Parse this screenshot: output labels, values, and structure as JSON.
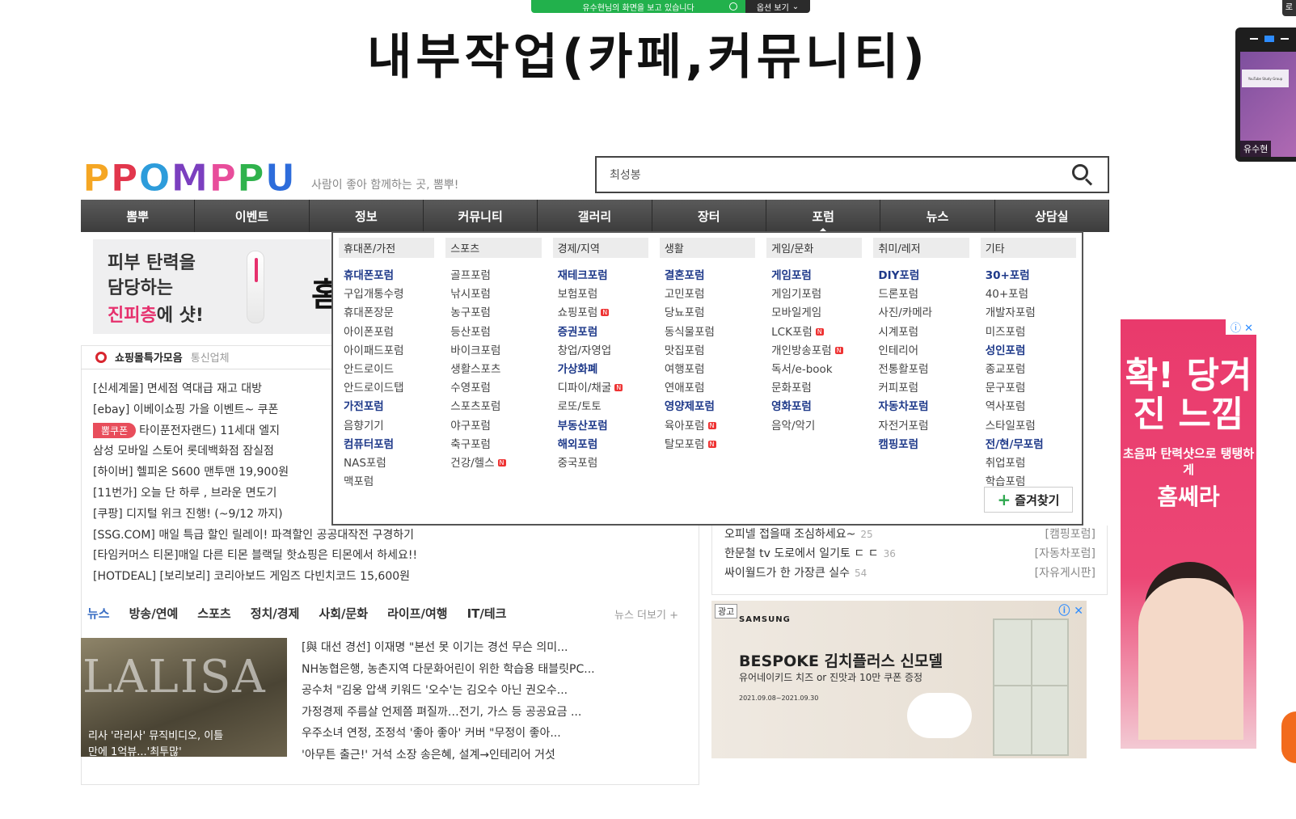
{
  "share_bar": {
    "message": "유수현님의 화면을 보고 있습니다",
    "options_label": "옵션 보기",
    "chevron": "chevron-down-icon"
  },
  "slide_title": "내부작업(카페,커뮤니티)",
  "corner_button_label": "로",
  "video_tile": {
    "participant_name": "유수현",
    "card_text": "YouTube Study Group"
  },
  "site": {
    "logo": "PPOMPPU",
    "tagline": "사람이 좋아 함께하는 곳, 뽐뿌!",
    "search": {
      "value": "최성봉",
      "icon": "search-icon"
    },
    "nav": [
      "뽐뿌",
      "이벤트",
      "정보",
      "커뮤니티",
      "갤러리",
      "장터",
      "포럼",
      "뉴스",
      "상담실"
    ],
    "skin_ad": {
      "line1": "피부 탄력을",
      "line2": "담당하는",
      "line3_highlight": "진피층",
      "line3_rest": "에 샷!",
      "big_char": "홈"
    },
    "shop_header": {
      "title": "쇼핑몰특가모음",
      "second": "통신업체"
    },
    "hot_deals": [
      "[신세계몰] 면세점 역대급 재고 대방",
      "[ebay] 이베이쇼핑 가을 이벤트~ 쿠폰 ",
      "타이푼전자랜드) 11세대 엘지",
      "삼성 모바일 스토어 롯데백화점 잠실점",
      "[하이버] 헬피온 S600 맨투맨 19,900원",
      "[11번가] 오늘 단 하루 , 브라운 면도기",
      "[쿠팡] 디지털 위크 진행! (~9/12 까지)",
      "[SSG.COM] 매일 특급 할인 릴레이! 파격할인 공공대작전 구경하기",
      "[타임커머스 티몬]매일 다른 티몬 블랙딜 핫쇼핑은 티몬에서 하세요!!",
      "[HOTDEAL] [보리보리] 코리아보드 게임즈 다빈치코드 15,600원"
    ],
    "coupon_tag": "뽐쿠폰",
    "forum_dropdown": {
      "columns": [
        {
          "title": "휴대폰/가전",
          "items": [
            {
              "t": "휴대폰포럼",
              "b": true
            },
            {
              "t": "구입개통수령"
            },
            {
              "t": "휴대폰장문"
            },
            {
              "t": "아이폰포럼"
            },
            {
              "t": "아이패드포럼"
            },
            {
              "t": "안드로이드"
            },
            {
              "t": "안드로이드탭"
            },
            {
              "t": "가전포럼",
              "b": true
            },
            {
              "t": "음향기기"
            },
            {
              "t": "컴퓨터포럼",
              "b": true
            },
            {
              "t": "NAS포럼"
            },
            {
              "t": "맥포럼"
            }
          ]
        },
        {
          "title": "스포츠",
          "items": [
            {
              "t": "골프포럼"
            },
            {
              "t": "낚시포럼"
            },
            {
              "t": "농구포럼"
            },
            {
              "t": "등산포럼"
            },
            {
              "t": "바이크포럼"
            },
            {
              "t": "생활스포츠"
            },
            {
              "t": "수영포럼"
            },
            {
              "t": "스포츠포럼"
            },
            {
              "t": "야구포럼"
            },
            {
              "t": "축구포럼"
            },
            {
              "t": "건강/헬스",
              "n": true
            }
          ]
        },
        {
          "title": "경제/지역",
          "items": [
            {
              "t": "재테크포럼",
              "b": true
            },
            {
              "t": "보험포럼"
            },
            {
              "t": "쇼핑포럼",
              "n": true
            },
            {
              "t": "증권포럼",
              "b": true
            },
            {
              "t": "창업/자영업"
            },
            {
              "t": "가상화폐",
              "b": true
            },
            {
              "t": "디파이/채굴",
              "n": true
            },
            {
              "t": "로또/토토"
            },
            {
              "t": "부동산포럼",
              "b": true
            },
            {
              "t": "해외포럼",
              "b": true
            },
            {
              "t": "중국포럼"
            }
          ]
        },
        {
          "title": "생활",
          "items": [
            {
              "t": "결혼포럼",
              "b": true
            },
            {
              "t": "고민포럼"
            },
            {
              "t": "당뇨포럼"
            },
            {
              "t": "동식물포럼"
            },
            {
              "t": "맛집포럼"
            },
            {
              "t": "여행포럼"
            },
            {
              "t": "연애포럼"
            },
            {
              "t": "영양제포럼",
              "b": true
            },
            {
              "t": "육아포럼",
              "n": true
            },
            {
              "t": "탈모포럼",
              "n": true
            }
          ]
        },
        {
          "title": "게임/문화",
          "items": [
            {
              "t": "게임포럼",
              "b": true
            },
            {
              "t": "게임기포럼"
            },
            {
              "t": "모바일게임"
            },
            {
              "t": "LCK포럼",
              "n": true
            },
            {
              "t": "개인방송포럼",
              "n": true
            },
            {
              "t": "독서/e-book"
            },
            {
              "t": "문화포럼"
            },
            {
              "t": "영화포럼",
              "b": true
            },
            {
              "t": "음악/악기"
            }
          ]
        },
        {
          "title": "취미/레저",
          "items": [
            {
              "t": "DIY포럼",
              "b": true
            },
            {
              "t": "드론포럼"
            },
            {
              "t": "사진/카메라"
            },
            {
              "t": "시계포럼"
            },
            {
              "t": "인테리어"
            },
            {
              "t": "전통활포럼"
            },
            {
              "t": "커피포럼"
            },
            {
              "t": "자동차포럼",
              "b": true
            },
            {
              "t": "자전거포럼"
            },
            {
              "t": "캠핑포럼",
              "b": true
            }
          ]
        },
        {
          "title": "기타",
          "items": [
            {
              "t": "30+포럼",
              "b": true
            },
            {
              "t": "40+포럼"
            },
            {
              "t": "개발자포럼"
            },
            {
              "t": "미즈포럼"
            },
            {
              "t": "성인포럼",
              "b": true
            },
            {
              "t": "종교포럼"
            },
            {
              "t": "문구포럼"
            },
            {
              "t": "역사포럼"
            },
            {
              "t": "스타일포럼"
            },
            {
              "t": "전/현/무포럼",
              "b": true
            },
            {
              "t": "취업포럼"
            },
            {
              "t": "학습포럼"
            }
          ]
        }
      ],
      "new_badge": "N",
      "favorite_button": "즐겨찾기"
    },
    "board": [
      {
        "title": "오피넬 접을때 조심하세요~",
        "count": "25",
        "category": "[캠핑포럼]"
      },
      {
        "title": "한문철 tv 도로에서 일기토 ㄷ ㄷ",
        "count": "36",
        "category": "[자동차포럼]"
      },
      {
        "title": "싸이월드가 한 가장큰 실수",
        "count": "54",
        "category": "[자유게시판]"
      }
    ],
    "news_tabs": [
      "뉴스",
      "방송/연예",
      "스포츠",
      "정치/경제",
      "사회/문화",
      "라이프/여행",
      "IT/테크"
    ],
    "news_more": "뉴스 더보기 +",
    "news_thumb": {
      "watermark": "LALISA",
      "caption1": "리사 '라리사' 뮤직비디오, 이틀",
      "caption2": "만에 1억뷰...'최투많'"
    },
    "news_items": [
      "[與 대선 경선] 이재명 \"본선 못 이기는 경선 무슨 의미...",
      "NH농협은행, 농촌지역 다문화어린이 위한 학습용 태블릿PC...",
      "공수처 \"김웅 압색 키워드 '오수'는 김오수 아닌 권오수...",
      "가정경제 주름살 언제쯤 펴질까…전기, 가스 등 공공요금 ...",
      "우주소녀 연정, 조정석 '좋아 좋아' 커버 \"무정이 좋아...",
      "'아무튼 출근!' 거석 소장 송은혜, 설계→인테리어 거섯"
    ],
    "bespoke_ad": {
      "ad_tag": "광고",
      "brand": "SAMSUNG",
      "headline": "BESPOKE 김치플러스 신모델",
      "sub": "유어네이키드 치즈 or 진맛과 10만 쿠폰 증정",
      "date": "2021.09.08~2021.09.30"
    },
    "side_ad": {
      "h1": "확! 당겨진 느낌",
      "s1": "초음파 탄력샷으로 탱탱하게",
      "brand": "홈쎄라"
    }
  }
}
